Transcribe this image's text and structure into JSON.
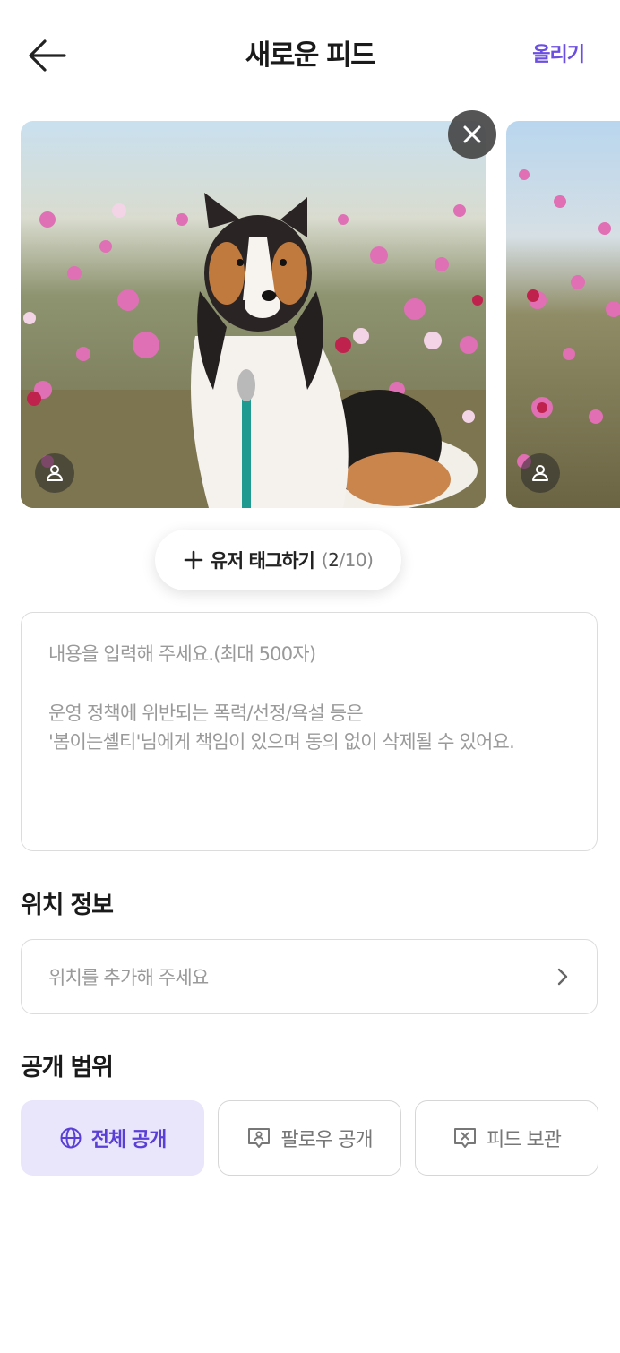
{
  "header": {
    "back_icon": "arrow-left-icon",
    "title": "새로운 피드",
    "upload_label": "올리기",
    "accent_color": "#6a4fe0"
  },
  "photos": [
    {
      "subject": "dog",
      "icons": [
        "close-icon",
        "person-icon"
      ]
    },
    {
      "subject": "flowers",
      "icons": [
        "person-icon"
      ]
    }
  ],
  "tag_button": {
    "icon": "plus-icon",
    "label": "유저 태그하기",
    "count_open": "(",
    "count_current": "2",
    "count_rest": "/10)"
  },
  "content": {
    "placeholder_line1": "내용을 입력해 주세요.(최대 500자)",
    "placeholder_line2": "운영 정책에 위반되는 폭력/선정/욕설 등은",
    "placeholder_line3": "'봄이는셸티'님에게 책임이 있으며 동의 없이 삭제될 수 있어요."
  },
  "location": {
    "section_title": "위치 정보",
    "placeholder": "위치를 추가해 주세요",
    "icon": "chevron-right-icon"
  },
  "visibility": {
    "section_title": "공개 범위",
    "selected_color": "#e9e5fb",
    "options": [
      {
        "label": "전체 공개",
        "icon": "globe-icon",
        "selected": true
      },
      {
        "label": "팔로우 공개",
        "icon": "follower-chat-icon",
        "selected": false
      },
      {
        "label": "피드 보관",
        "icon": "archive-chat-icon",
        "selected": false
      }
    ]
  }
}
